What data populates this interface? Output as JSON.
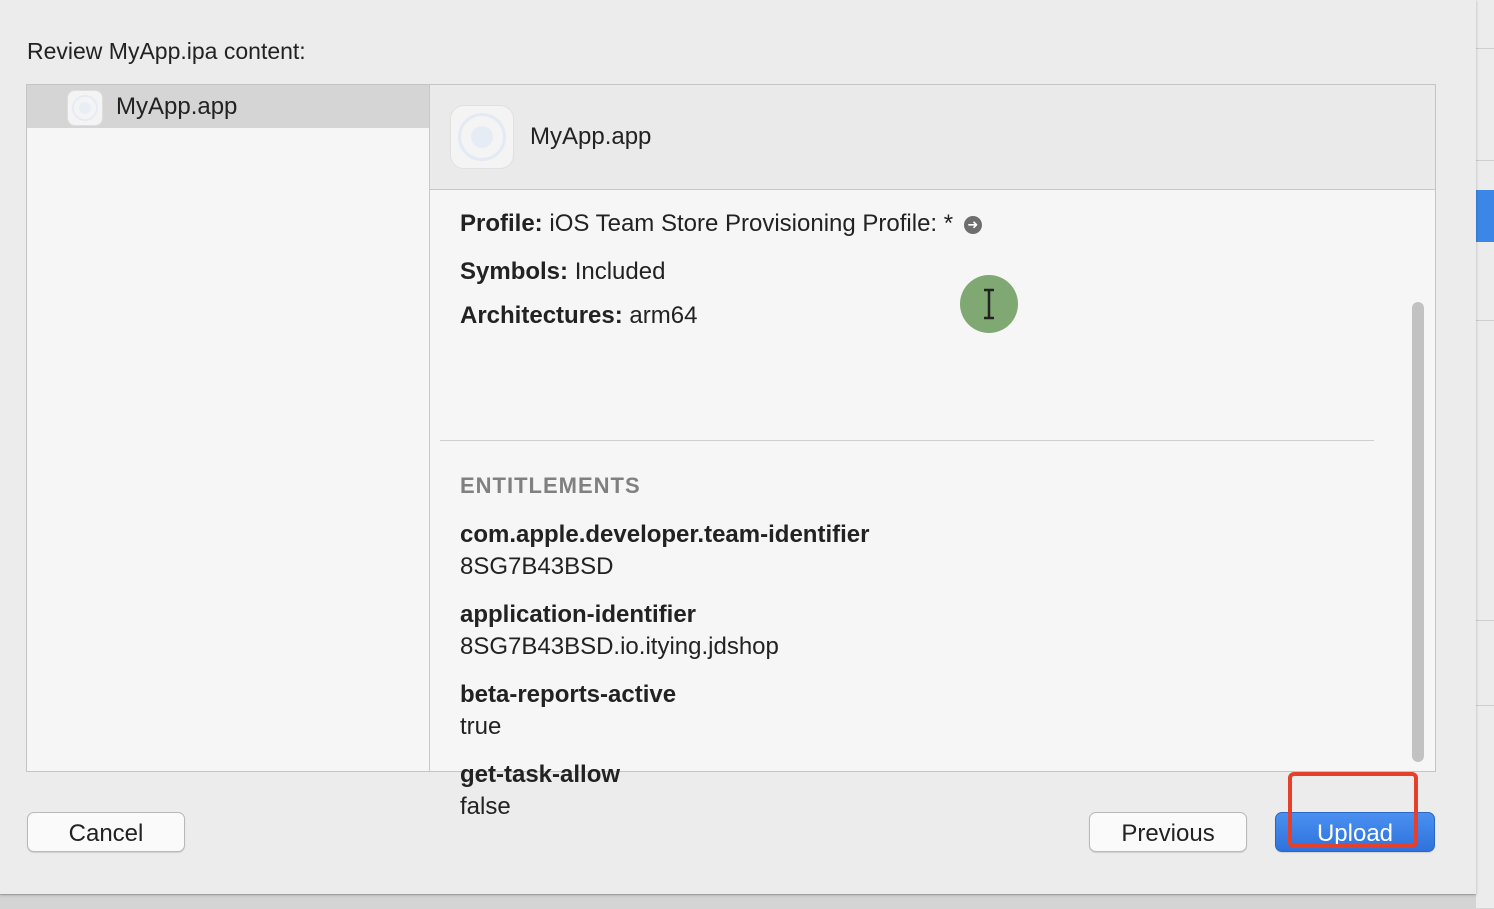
{
  "dialog": {
    "title": "Review MyApp.ipa content:"
  },
  "sidebar": {
    "items": [
      {
        "label": "MyApp.app",
        "icon": "app-icon"
      }
    ]
  },
  "detail": {
    "header_label": "MyApp.app",
    "profile_label": "Profile:",
    "profile_value": "iOS Team Store Provisioning Profile: *",
    "symbols_label": "Symbols:",
    "symbols_value": "Included",
    "architectures_label": "Architectures:",
    "architectures_value": "arm64",
    "entitlements_heading": "ENTITLEMENTS",
    "entitlements": [
      {
        "key": "com.apple.developer.team-identifier",
        "value": "8SG7B43BSD"
      },
      {
        "key": "application-identifier",
        "value": "8SG7B43BSD.io.itying.jdshop"
      },
      {
        "key": "beta-reports-active",
        "value": "true"
      },
      {
        "key": "get-task-allow",
        "value": "false"
      }
    ]
  },
  "buttons": {
    "cancel": "Cancel",
    "previous": "Previous",
    "upload": "Upload"
  },
  "colors": {
    "accent": "#3b86e6",
    "highlight": "#e7402a",
    "cursor": "#7fa872"
  }
}
